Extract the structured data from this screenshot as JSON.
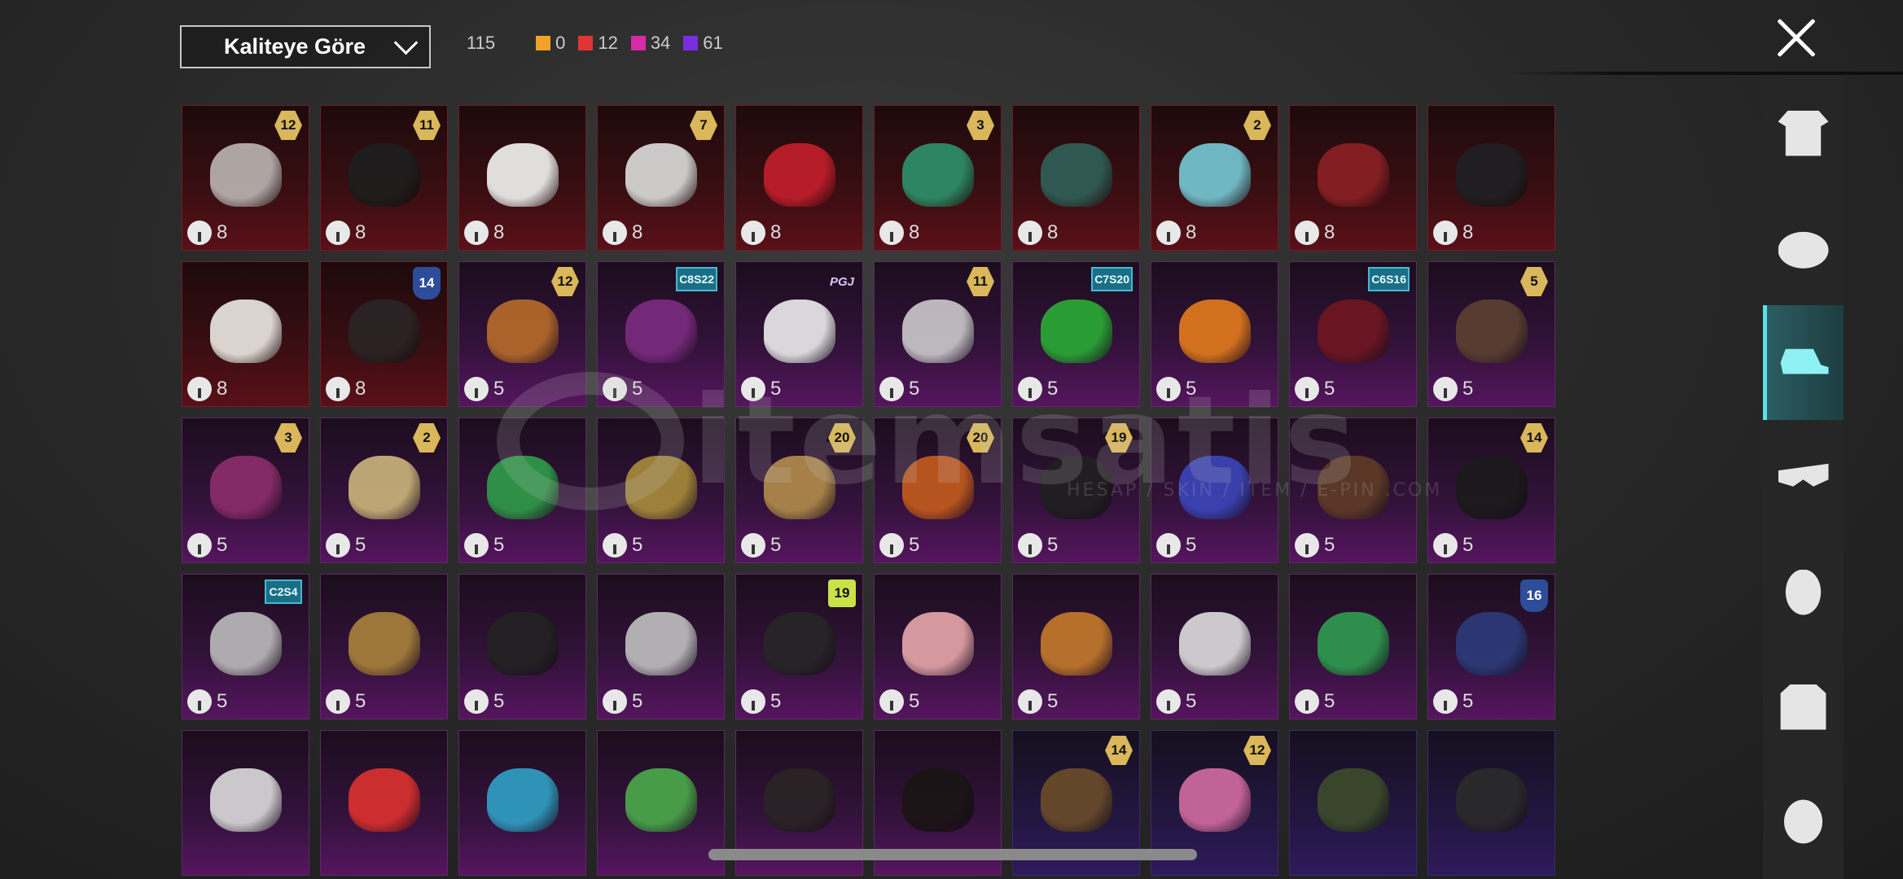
{
  "toolbar": {
    "sort_label": "Kaliteye Göre",
    "total": "115",
    "counts": [
      {
        "color": "#f2a12a",
        "value": "0"
      },
      {
        "color": "#e23434",
        "value": "12"
      },
      {
        "color": "#d62aa6",
        "value": "34"
      },
      {
        "color": "#7a2ee0",
        "value": "61"
      }
    ]
  },
  "watermark": {
    "text": "itemsatis",
    "sub": "HESAP / SKIN / ITEM / E-PIN .COM"
  },
  "sidebar": [
    {
      "icon": "outfit-icon",
      "active": false
    },
    {
      "icon": "helmet-icon",
      "active": false
    },
    {
      "icon": "cap-icon",
      "active": true
    },
    {
      "icon": "goggles-icon",
      "active": false
    },
    {
      "icon": "mask-icon",
      "active": false
    },
    {
      "icon": "jacket-icon",
      "active": false
    },
    {
      "icon": "face-icon",
      "active": false
    }
  ],
  "items": [
    {
      "q": "red",
      "badge": "12",
      "bt": "gold",
      "price": "8",
      "color": "#b9b2b0"
    },
    {
      "q": "red",
      "badge": "11",
      "bt": "gold",
      "price": "8",
      "color": "#1d1d1d"
    },
    {
      "q": "red",
      "badge": "",
      "bt": "",
      "price": "8",
      "color": "#efefef"
    },
    {
      "q": "red",
      "badge": "7",
      "bt": "gold",
      "price": "8",
      "color": "#d9d9d9"
    },
    {
      "q": "red",
      "badge": "",
      "bt": "",
      "price": "8",
      "color": "#c01e2a"
    },
    {
      "q": "red",
      "badge": "3",
      "bt": "gold",
      "price": "8",
      "color": "#2c8f6a"
    },
    {
      "q": "red",
      "badge": "",
      "bt": "",
      "price": "8",
      "color": "#2f5e57"
    },
    {
      "q": "red",
      "badge": "2",
      "bt": "gold",
      "price": "8",
      "color": "#74c6d2"
    },
    {
      "q": "red",
      "badge": "",
      "bt": "",
      "price": "8",
      "color": "#8a2024"
    },
    {
      "q": "red",
      "badge": "",
      "bt": "",
      "price": "8",
      "color": "#1f1f24"
    },
    {
      "q": "red",
      "badge": "",
      "bt": "",
      "price": "8",
      "color": "#e9e5df"
    },
    {
      "q": "red",
      "badge": "14",
      "bt": "blue",
      "price": "8",
      "color": "#2a2426"
    },
    {
      "q": "pink",
      "badge": "12",
      "bt": "gold",
      "price": "5",
      "color": "#b46a2a"
    },
    {
      "q": "pink",
      "badge": "C8S22",
      "bt": "teal",
      "price": "5",
      "color": "#7a2a7e"
    },
    {
      "q": "pink",
      "badge": "PGJ",
      "bt": "pgj",
      "price": "5",
      "color": "#e8e8e8"
    },
    {
      "q": "pink",
      "badge": "11",
      "bt": "gold",
      "price": "5",
      "color": "#c9c5c9"
    },
    {
      "q": "pink",
      "badge": "C7S20",
      "bt": "teal",
      "price": "5",
      "color": "#2aa834"
    },
    {
      "q": "pink",
      "badge": "",
      "bt": "",
      "price": "5",
      "color": "#e0791c"
    },
    {
      "q": "pink",
      "badge": "C6S16",
      "bt": "teal",
      "price": "5",
      "color": "#6e1620"
    },
    {
      "q": "pink",
      "badge": "5",
      "bt": "gold",
      "price": "5",
      "color": "#5a4030"
    },
    {
      "q": "pink",
      "badge": "3",
      "bt": "gold",
      "price": "5",
      "color": "#8a2c6a"
    },
    {
      "q": "pink",
      "badge": "2",
      "bt": "gold",
      "price": "5",
      "color": "#c9b27a"
    },
    {
      "q": "pink",
      "badge": "",
      "bt": "",
      "price": "5",
      "color": "#2f9a48"
    },
    {
      "q": "pink",
      "badge": "",
      "bt": "",
      "price": "5",
      "color": "#a68a3a"
    },
    {
      "q": "pink",
      "badge": "20",
      "bt": "gold",
      "price": "5",
      "color": "#b08a4a"
    },
    {
      "q": "pink",
      "badge": "20",
      "bt": "gold",
      "price": "5",
      "color": "#c25a1e"
    },
    {
      "q": "pink",
      "badge": "19",
      "bt": "gold",
      "price": "5",
      "color": "#1f1f1f"
    },
    {
      "q": "pink",
      "badge": "",
      "bt": "",
      "price": "5",
      "color": "#3a44b6"
    },
    {
      "q": "pink",
      "badge": "",
      "bt": "",
      "price": "5",
      "color": "#5e3a26"
    },
    {
      "q": "pink",
      "badge": "14",
      "bt": "gold",
      "price": "5",
      "color": "#1a1a1a"
    },
    {
      "q": "pink",
      "badge": "C2S4",
      "bt": "teal",
      "price": "5",
      "color": "#b8b8b8"
    },
    {
      "q": "pink",
      "badge": "",
      "bt": "",
      "price": "5",
      "color": "#a77f3a"
    },
    {
      "q": "pink",
      "badge": "",
      "bt": "",
      "price": "5",
      "color": "#222"
    },
    {
      "q": "pink",
      "badge": "",
      "bt": "",
      "price": "5",
      "color": "#bdbdbd"
    },
    {
      "q": "pink",
      "badge": "19",
      "bt": "lime",
      "price": "5",
      "color": "#262626"
    },
    {
      "q": "pink",
      "badge": "",
      "bt": "",
      "price": "5",
      "color": "#e3a4a8"
    },
    {
      "q": "pink",
      "badge": "",
      "bt": "",
      "price": "5",
      "color": "#c2782a"
    },
    {
      "q": "pink",
      "badge": "",
      "bt": "",
      "price": "5",
      "color": "#d9d9d9"
    },
    {
      "q": "pink",
      "badge": "",
      "bt": "",
      "price": "5",
      "color": "#2e9a4e"
    },
    {
      "q": "pink",
      "badge": "16",
      "bt": "blue",
      "price": "5",
      "color": "#2b3a78"
    },
    {
      "q": "pink",
      "badge": "",
      "bt": "",
      "price": "",
      "color": "#d8d8d8"
    },
    {
      "q": "pink",
      "badge": "",
      "bt": "",
      "price": "",
      "color": "#d9302e"
    },
    {
      "q": "pink",
      "badge": "",
      "bt": "",
      "price": "",
      "color": "#2f9ec2"
    },
    {
      "q": "pink",
      "badge": "",
      "bt": "",
      "price": "",
      "color": "#4aa84a"
    },
    {
      "q": "pink",
      "badge": "",
      "bt": "",
      "price": "",
      "color": "#2a2424"
    },
    {
      "q": "pink",
      "badge": "",
      "bt": "",
      "price": "",
      "color": "#1a1414"
    },
    {
      "q": "purple",
      "badge": "14",
      "bt": "gold",
      "price": "",
      "color": "#6a4a2a"
    },
    {
      "q": "purple",
      "badge": "12",
      "bt": "gold",
      "price": "",
      "color": "#d06aa0"
    },
    {
      "q": "purple",
      "badge": "",
      "bt": "",
      "price": "",
      "color": "#3c4a2a"
    },
    {
      "q": "purple",
      "badge": "",
      "bt": "",
      "price": "",
      "color": "#2a2a2a"
    }
  ]
}
